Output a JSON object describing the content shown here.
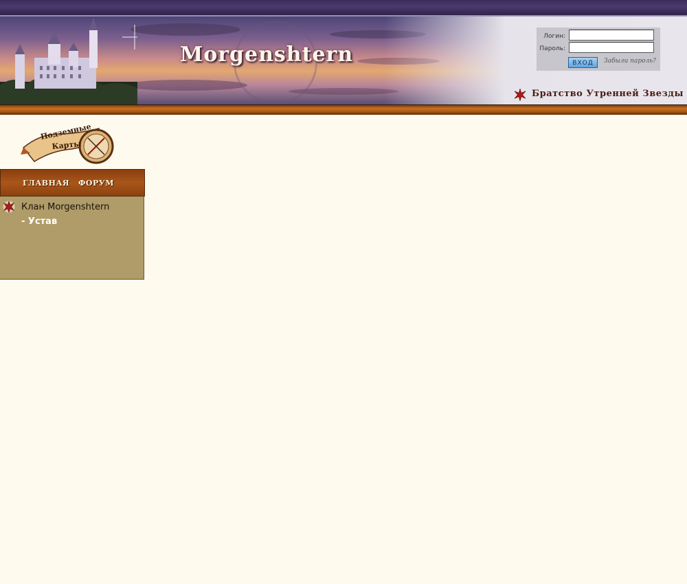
{
  "header": {
    "logo_title": "Morgenshtern",
    "tagline": "Братство Утренней Звезды"
  },
  "login": {
    "login_label": "Логин:",
    "password_label": "Пароль:",
    "login_value": "",
    "password_value": "",
    "enter_button": "ВХОД",
    "forgot_link": "Забыли пароль?"
  },
  "sidebar": {
    "maps_logo_line1": "Подземные",
    "maps_logo_line2": "Карты",
    "nav": [
      {
        "label": "ГЛАВНАЯ"
      },
      {
        "label": "ФОРУМ"
      }
    ],
    "menu_item": "Клан Morgenshtern",
    "submenu_item": "-  Устав"
  },
  "colors": {
    "page_bg": "#fffaee",
    "accent_orange": "#a9561a",
    "menu_bg": "#b09c68",
    "top_purple": "#3b2c5a",
    "star_red": "#b01818"
  }
}
